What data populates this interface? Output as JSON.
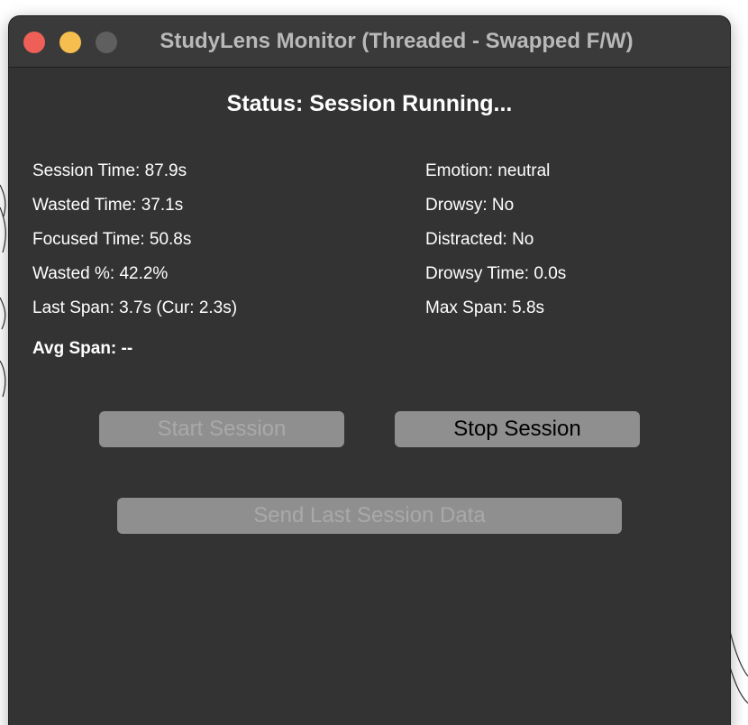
{
  "window": {
    "title": "StudyLens Monitor (Threaded - Swapped F/W)"
  },
  "status": "Status: Session Running...",
  "stats_left": [
    "Session Time: 87.9s",
    "Wasted Time: 37.1s",
    "Focused Time: 50.8s",
    "Wasted %: 42.2%",
    "Last Span: 3.7s (Cur: 2.3s)"
  ],
  "stats_right": [
    "Emotion: neutral",
    "Drowsy: No",
    "Distracted: No",
    "Drowsy Time: 0.0s",
    "Max Span: 5.8s"
  ],
  "avg_span": "Avg Span: --",
  "buttons": {
    "start": "Start Session",
    "stop": "Stop Session",
    "send": "Send Last Session Data"
  },
  "colors": {
    "window_bg": "#333333",
    "close": "#ee5f57",
    "minimize": "#f5be4f",
    "maximize_disabled": "#5f5f5f",
    "button_bg": "#8f8f8f",
    "disabled_text": "#a9a9a9"
  }
}
